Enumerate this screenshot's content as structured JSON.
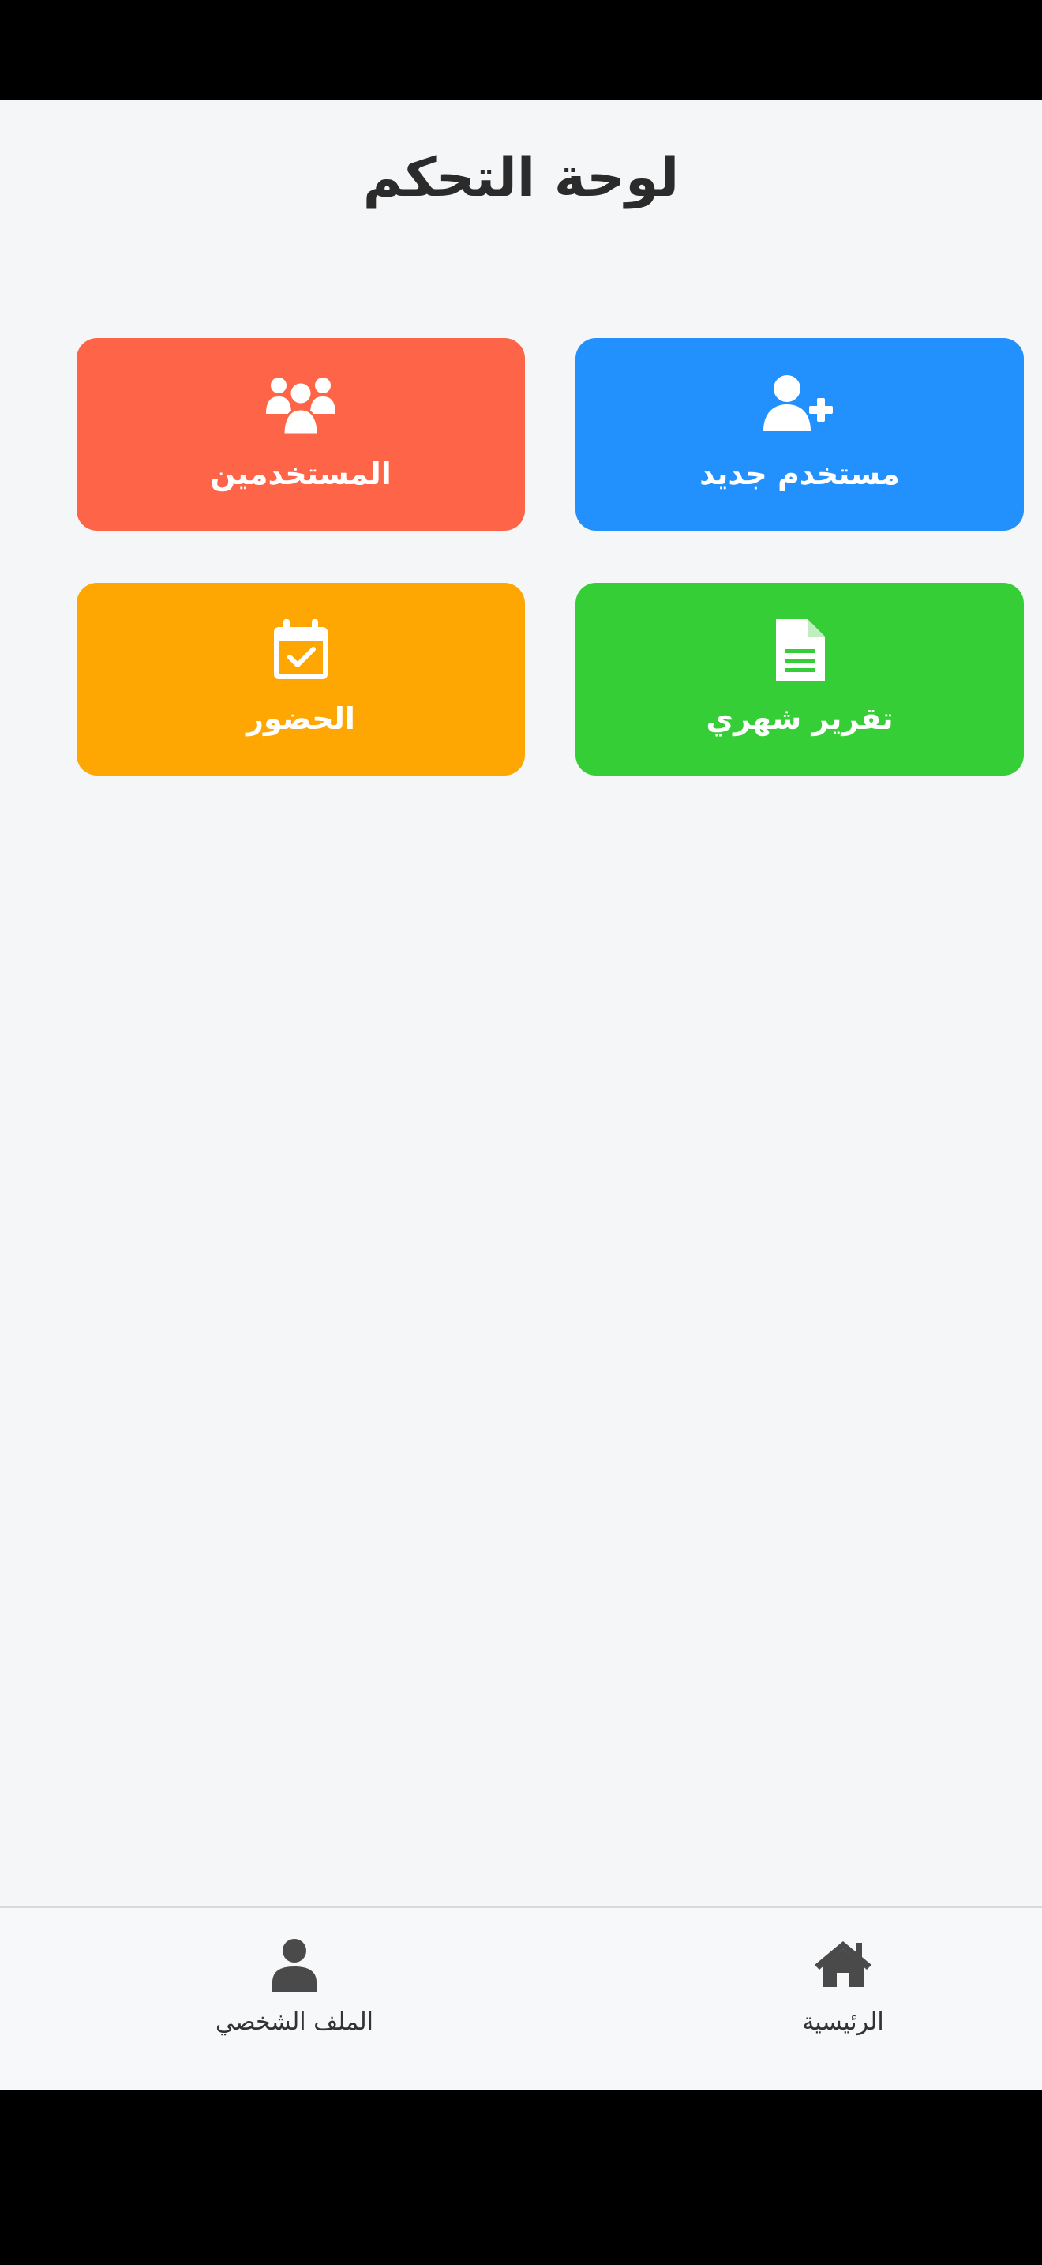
{
  "header": {
    "title": "لوحة التحكم"
  },
  "cards": [
    {
      "label": "مستخدم جديد",
      "icon": "add-user-icon",
      "color": "#2391fd"
    },
    {
      "label": "المستخدمين",
      "icon": "users-icon",
      "color": "#fe6448"
    },
    {
      "label": "تقرير شهري",
      "icon": "document-icon",
      "color": "#36ce36"
    },
    {
      "label": "الحضور",
      "icon": "calendar-check-icon",
      "color": "#fea602"
    }
  ],
  "tabbar": {
    "items": [
      {
        "label": "الرئيسية",
        "icon": "home-icon"
      },
      {
        "label": "الملف الشخصي",
        "icon": "profile-icon"
      }
    ]
  }
}
